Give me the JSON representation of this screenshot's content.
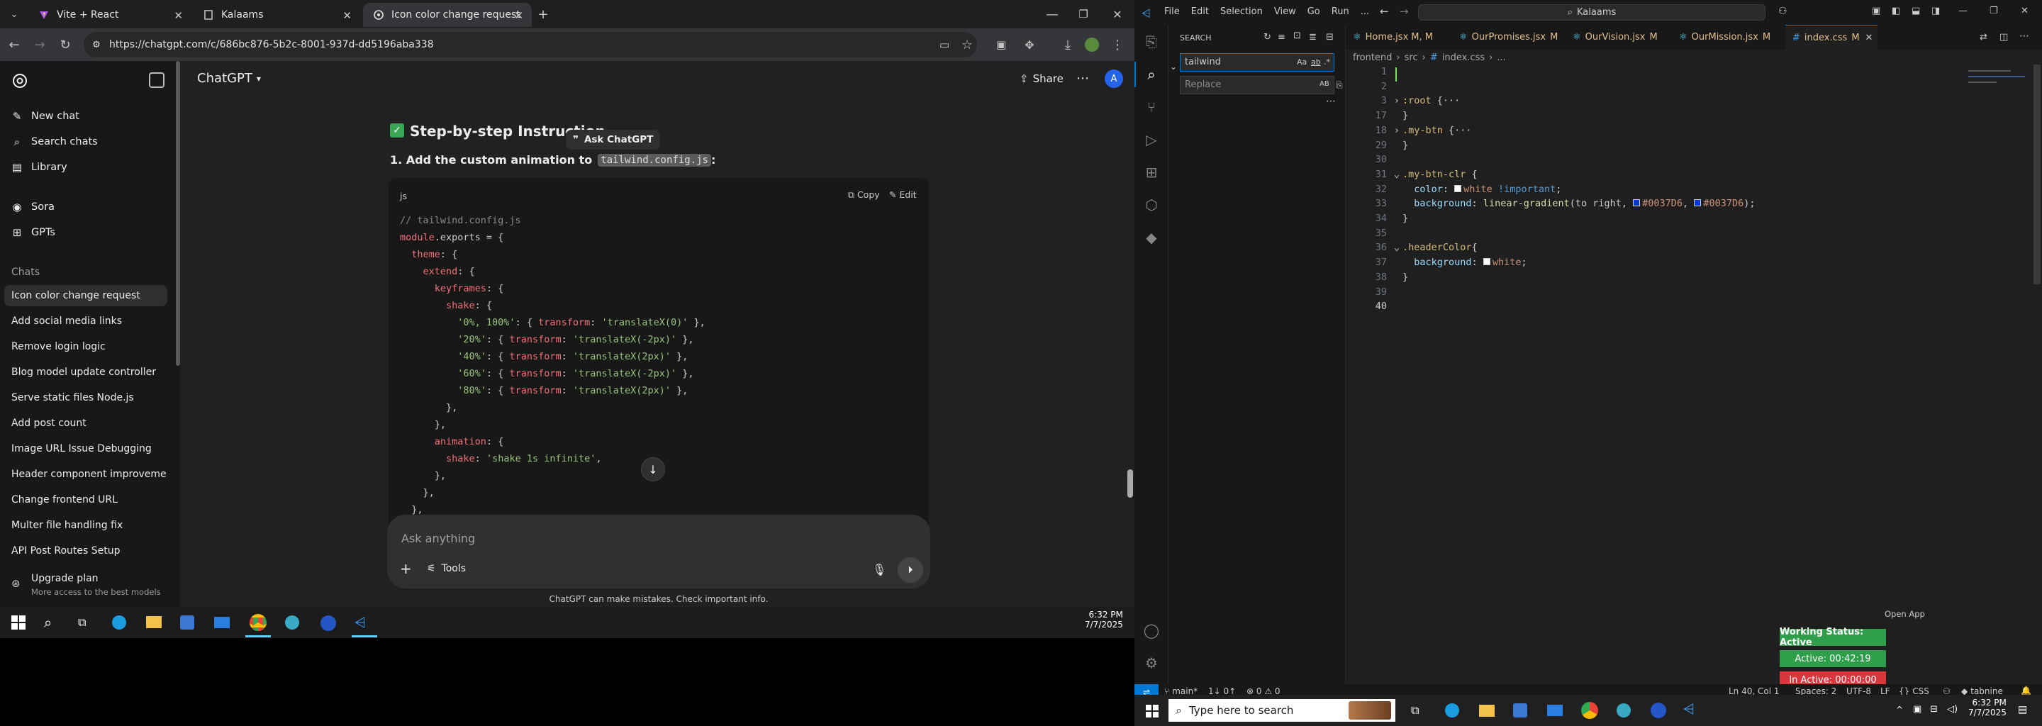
{
  "chrome": {
    "tabs": [
      {
        "title": "Vite + React",
        "active": false
      },
      {
        "title": "Kalaams",
        "active": false
      },
      {
        "title": "Icon color change request",
        "active": true
      }
    ],
    "url": "https://chatgpt.com/c/686bc876-5b2c-8001-937d-dd5196aba338"
  },
  "chatgpt": {
    "sidebar": {
      "new_chat": "New chat",
      "search_chats": "Search chats",
      "library": "Library",
      "sora": "Sora",
      "gpts": "GPTs",
      "chats_heading": "Chats",
      "chats": [
        "Icon color change request",
        "Add social media links",
        "Remove login logic",
        "Blog model update controller",
        "Serve static files Node.js",
        "Add post count",
        "Image URL Issue Debugging",
        "Header component improveme...",
        "Change frontend URL",
        "Multer file handling fix",
        "API Post Routes Setup"
      ],
      "upgrade_title": "Upgrade plan",
      "upgrade_sub": "More access to the best models"
    },
    "header": {
      "model": "ChatGPT",
      "share": "Share",
      "avatar": "A"
    },
    "content": {
      "heading": "Step-by-step Instruction",
      "ask_popup": "Ask ChatGPT",
      "step1_prefix": "1. Add the custom animation to",
      "step1_code": "tailwind.config.js",
      "step1_suffix": ":",
      "code_lang": "js",
      "copy": "Copy",
      "edit": "Edit",
      "code_lines": [
        "// tailwind.config.js",
        "module.exports = {",
        "  theme: {",
        "    extend: {",
        "      keyframes: {",
        "        shake: {",
        "          '0%, 100%': { transform: 'translateX(0)' },",
        "          '20%': { transform: 'translateX(-2px)' },",
        "          '40%': { transform: 'translateX(2px)' },",
        "          '60%': { transform: 'translateX(-2px)' },",
        "          '80%': { transform: 'translateX(2px)' },",
        "        },",
        "      },",
        "      animation: {",
        "        shake: 'shake 1s infinite',",
        "      },",
        "    },",
        "  },"
      ]
    },
    "composer": {
      "placeholder": "Ask anything",
      "tools": "Tools"
    },
    "footer": "ChatGPT can make mistakes. Check important info."
  },
  "taskbar_left": {
    "time": "6:32 PM",
    "date": "7/7/2025"
  },
  "vscode": {
    "menu": [
      "File",
      "Edit",
      "Selection",
      "View",
      "Go",
      "Run",
      "..."
    ],
    "search_box": "Kalaams",
    "sidebar": {
      "title": "SEARCH",
      "search_value": "tailwind",
      "replace_placeholder": "Replace",
      "opt_case": "Aa",
      "opt_word": "ab",
      "opt_regex": ".*",
      "opt_preserve": "AB"
    },
    "tabs": [
      {
        "name": "Home.jsx",
        "status": "M, M"
      },
      {
        "name": "OurPromises.jsx",
        "status": "M"
      },
      {
        "name": "OurVision.jsx",
        "status": "M"
      },
      {
        "name": "OurMission.jsx",
        "status": "M"
      },
      {
        "name": "index.css",
        "status": "M"
      }
    ],
    "breadcrumb": [
      "frontend",
      "src",
      "index.css",
      "..."
    ],
    "lines": [
      {
        "n": "1",
        "t": ""
      },
      {
        "n": "2",
        "t": ""
      },
      {
        "n": "3",
        "t": ":root {···"
      },
      {
        "n": "17",
        "t": "}"
      },
      {
        "n": "18",
        "t": ".my-btn {···"
      },
      {
        "n": "29",
        "t": "}"
      },
      {
        "n": "30",
        "t": ""
      },
      {
        "n": "31",
        "t": ".my-btn-clr {"
      },
      {
        "n": "32",
        "t": "  color: white !important;"
      },
      {
        "n": "33",
        "t": "  background: linear-gradient(to right, #0037D6, #0037D6);"
      },
      {
        "n": "34",
        "t": "}"
      },
      {
        "n": "35",
        "t": ""
      },
      {
        "n": "36",
        "t": ".headerColor{"
      },
      {
        "n": "37",
        "t": "  background: white;"
      },
      {
        "n": "38",
        "t": "}"
      },
      {
        "n": "39",
        "t": ""
      },
      {
        "n": "40",
        "t": ""
      }
    ],
    "open_app": "Open App",
    "working_status": "Working Status: Active",
    "active_time": "Active: 00:42:19",
    "inactive_time": "In Active: 00:00:00",
    "status": {
      "branch": "main*",
      "sync": "1↓ 0↑",
      "problems": "⊗ 0 ⚠ 0",
      "position": "Ln 40, Col 1",
      "spaces": "Spaces: 2",
      "encoding": "UTF-8",
      "eol": "LF",
      "language": "CSS",
      "tabnine": "tabnine"
    }
  },
  "taskbar_right": {
    "search_placeholder": "Type here to search",
    "time": "6:32 PM",
    "date": "7/7/2025"
  },
  "colors": {
    "accent_blue": "#0078d4",
    "gradient_blue": "#0037D6",
    "green_badge": "#2e9e4a",
    "red_badge": "#d9363e"
  }
}
